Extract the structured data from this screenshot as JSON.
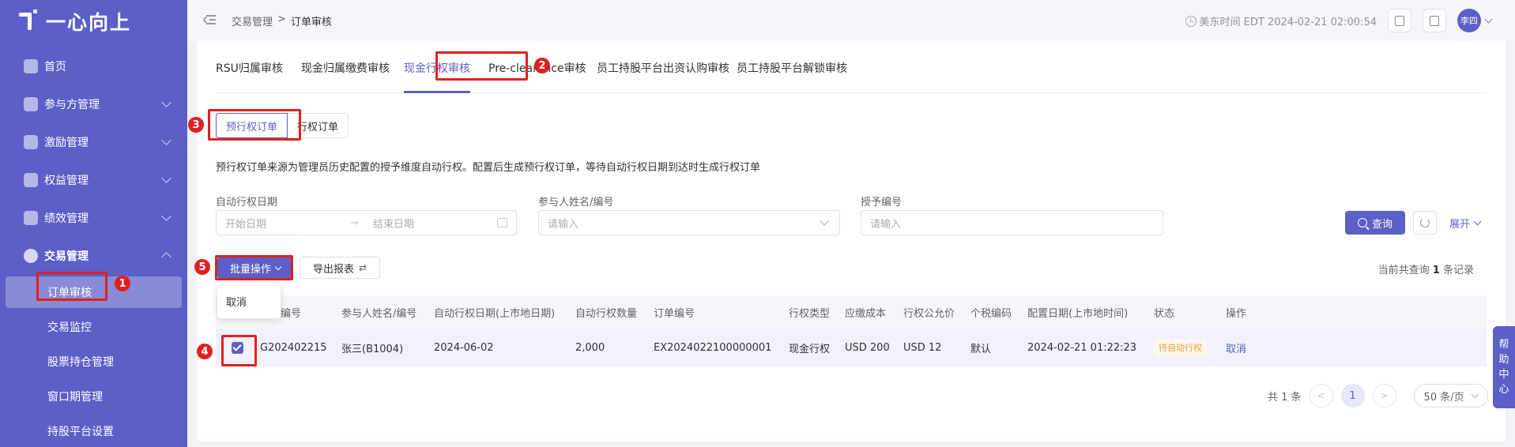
{
  "app": {
    "logo_text": "一心向上"
  },
  "sidebar": {
    "items": [
      {
        "label": "首页"
      },
      {
        "label": "参与方管理"
      },
      {
        "label": "激励管理"
      },
      {
        "label": "权益管理"
      },
      {
        "label": "绩效管理"
      },
      {
        "label": "交易管理"
      }
    ],
    "sub_items": [
      {
        "label": "订单审核"
      },
      {
        "label": "交易监控"
      },
      {
        "label": "股票持仓管理"
      },
      {
        "label": "窗口期管理"
      },
      {
        "label": "持股平台设置"
      }
    ]
  },
  "header": {
    "breadcrumb": [
      "交易管理",
      ">",
      "订单审核"
    ],
    "time_text": "美东时间 EDT 2024-02-21 02:00:54",
    "user_name": "李四"
  },
  "tabs": [
    "RSU归属审核",
    "现金归属缴费审核",
    "现金行权审核",
    "Pre-clearance审核",
    "员工持股平台出资认购审核",
    "员工持股平台解锁审核"
  ],
  "sub_tabs": [
    "预行权订单",
    "行权订单"
  ],
  "description": "预行权订单来源为管理员历史配置的授予维度自动行权。配置后生成预行权订单，等待自动行权日期到达时生成行权订单",
  "filters": {
    "date_label": "自动行权日期",
    "start_placeholder": "开始日期",
    "end_placeholder": "结束日期",
    "date_separator": "→",
    "participant_label": "参与人姓名/编号",
    "participant_placeholder": "请输入",
    "grant_label": "授予编号",
    "grant_placeholder": "请输入",
    "query_button": "查询",
    "expand_button": "展开"
  },
  "toolbar": {
    "batch_button": "批量操作",
    "export_button": "导出报表",
    "dropdown_cancel": "取消",
    "record_prefix": "当前共查询",
    "record_count": "1",
    "record_suffix": "条记录"
  },
  "table": {
    "headers": [
      "授予编号",
      "参与人姓名/编号",
      "自动行权日期(上市地日期)",
      "自动行权数量",
      "订单编号",
      "行权类型",
      "应缴成本",
      "行权公允价",
      "个税编码",
      "配置日期(上市地时间)",
      "状态",
      "操作"
    ],
    "rows": [
      [
        "G202402215",
        "张三(B1004)",
        "2024-06-02",
        "2,000",
        "EX2024022100000001",
        "现金行权",
        "USD 200",
        "USD 12",
        "默认",
        "2024-02-21 01:22:23",
        "待自动行权",
        "取消"
      ]
    ]
  },
  "pagination": {
    "total_text": "共 1 条",
    "current_page": "1",
    "prev": "<",
    "next": ">",
    "page_size": "50 条/页"
  },
  "help": {
    "chars": [
      "帮",
      "助",
      "中",
      "心"
    ]
  },
  "annotations": [
    "1",
    "2",
    "3",
    "4",
    "5"
  ],
  "colors": {
    "primary": "#5b5fc7",
    "highlight": "#e02020",
    "status_pending": "#e6a23c"
  }
}
